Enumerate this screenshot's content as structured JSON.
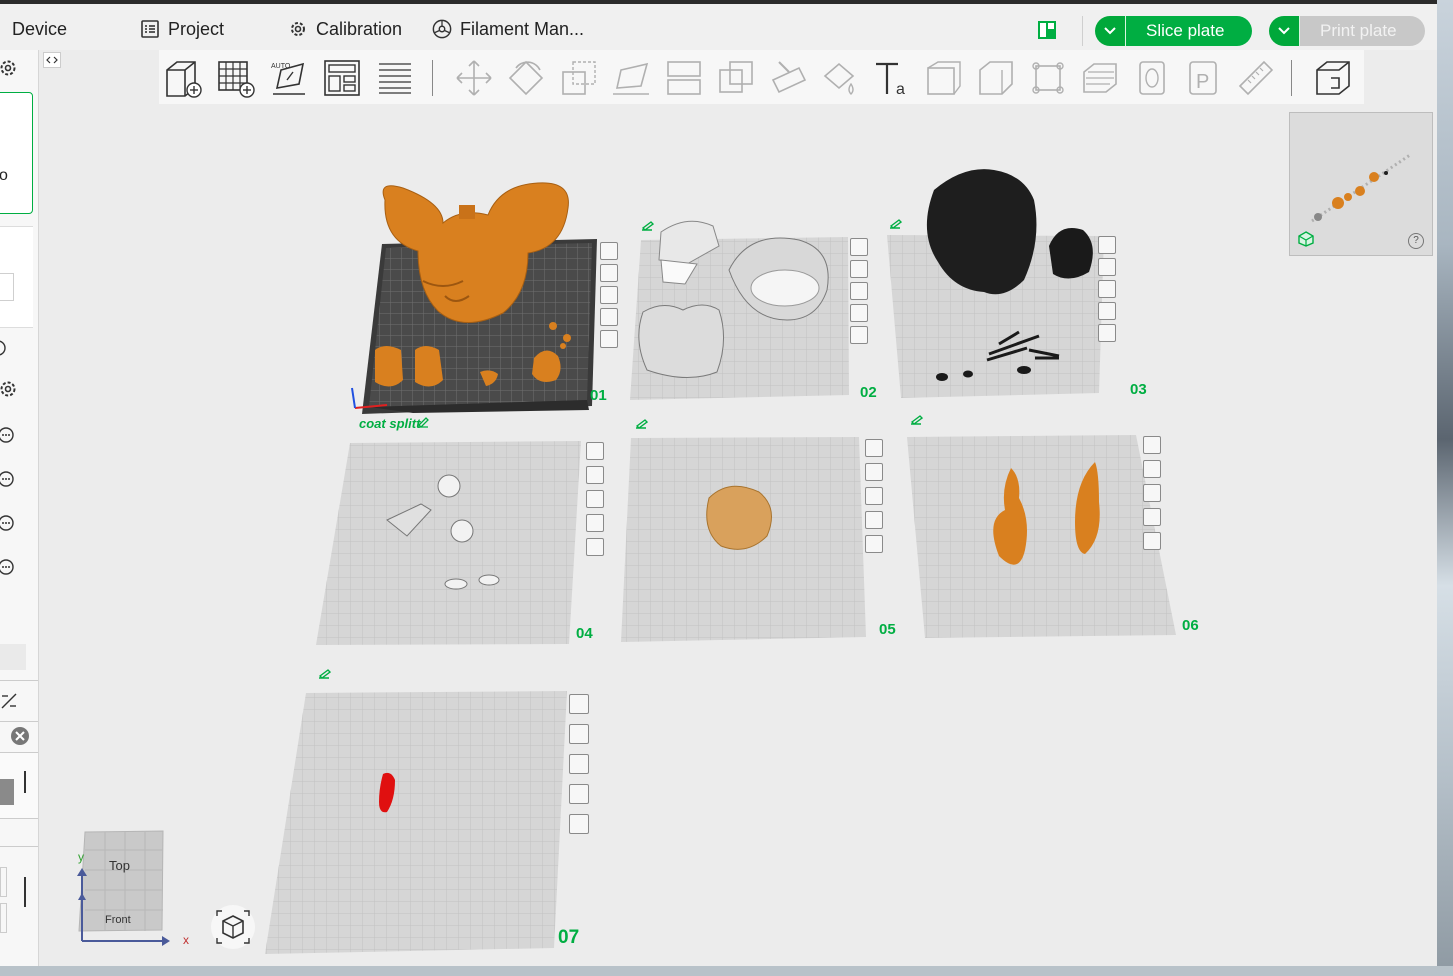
{
  "menu": {
    "device": "Device",
    "project": "Project",
    "calibration": "Calibration",
    "filament": "Filament Man..."
  },
  "actions": {
    "slice": "Slice plate",
    "print": "Print plate"
  },
  "plates": {
    "p1": "01",
    "p1_name": "coat splitt",
    "p2": "02",
    "p3": "03",
    "p4": "04",
    "p5": "05",
    "p6": "06",
    "p7": "07"
  },
  "viewcube": {
    "top": "Top",
    "front": "Front",
    "axis_x": "x",
    "axis_y": "y"
  },
  "sidebar": {
    "partial_letter": "o"
  },
  "thumbnail": {
    "help": "?"
  },
  "colors": {
    "accent": "#00ae42",
    "filament_orange": "#d9801f",
    "filament_black": "#1e1e1e",
    "filament_white": "#e8e8e8",
    "filament_tan": "#d9a15c",
    "filament_red": "#e01010",
    "bed_grey": "#d4d4d4"
  }
}
